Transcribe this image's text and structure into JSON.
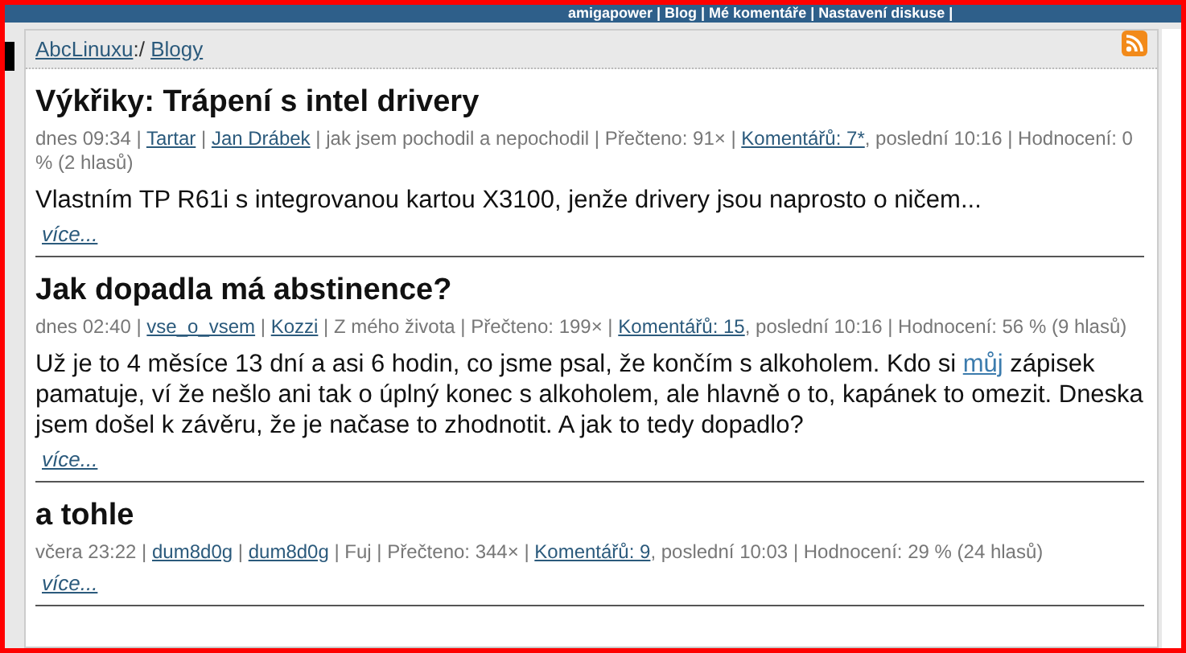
{
  "top_bar": {
    "text": "amigapower | Blog | Mé komentáře | Nastavení diskuse |"
  },
  "breadcrumb": [
    {
      "text": "AbcLinuxu",
      "link": true
    },
    {
      "text": ":/ ",
      "link": false
    },
    {
      "text": "Blogy",
      "link": true
    }
  ],
  "posts": [
    {
      "title": "Výkřiky: Trápení s intel drivery",
      "meta": [
        {
          "text": "dnes 09:34 | ",
          "link": false
        },
        {
          "text": "Tartar",
          "link": true
        },
        {
          "text": " | ",
          "link": false
        },
        {
          "text": "Jan Drábek",
          "link": true
        },
        {
          "text": " | jak jsem pochodil a nepochodil | Přečteno: 91× | ",
          "link": false
        },
        {
          "text": "Komentářů: 7*",
          "link": true
        },
        {
          "text": ", poslední 10:16 | Hodnocení: 0 % (2 hlasů)",
          "link": false
        }
      ],
      "body": [
        {
          "text": "Vlastním TP R61i s integrovanou kartou X3100, jenže drivery jsou naprosto o ničem...",
          "link": false
        }
      ],
      "more": "více..."
    },
    {
      "title": "Jak dopadla má abstinence?",
      "meta": [
        {
          "text": "dnes 02:40 | ",
          "link": false
        },
        {
          "text": "vse_o_vsem",
          "link": true
        },
        {
          "text": " | ",
          "link": false
        },
        {
          "text": "Kozzi",
          "link": true
        },
        {
          "text": " | Z mého života | Přečteno: 199× | ",
          "link": false
        },
        {
          "text": "Komentářů: 15",
          "link": true
        },
        {
          "text": ", poslední 10:16 | Hodnocení: 56 % (9 hlasů)",
          "link": false
        }
      ],
      "body": [
        {
          "text": "Už je to 4 měsíce 13 dní a asi 6 hodin, co jsme psal, že končím s alkoholem. Kdo si ",
          "link": false
        },
        {
          "text": "můj",
          "link": true
        },
        {
          "text": " zápisek pamatuje, ví že nešlo ani tak o úplný konec s alkoholem, ale hlavně o to, kapánek to omezit. Dneska jsem došel k závěru, že je načase to zhodnotit. A jak to tedy dopadlo?",
          "link": false
        }
      ],
      "more": "více..."
    },
    {
      "title": "a tohle",
      "meta": [
        {
          "text": "včera 23:22 | ",
          "link": false
        },
        {
          "text": "dum8d0g",
          "link": true
        },
        {
          "text": " | ",
          "link": false
        },
        {
          "text": "dum8d0g",
          "link": true
        },
        {
          "text": " | Fuj | Přečteno: 344× | ",
          "link": false
        },
        {
          "text": "Komentářů: 9",
          "link": true
        },
        {
          "text": ", poslední 10:03 | Hodnocení: 29 % (24 hlasů)",
          "link": false
        }
      ],
      "more": "více..."
    }
  ]
}
